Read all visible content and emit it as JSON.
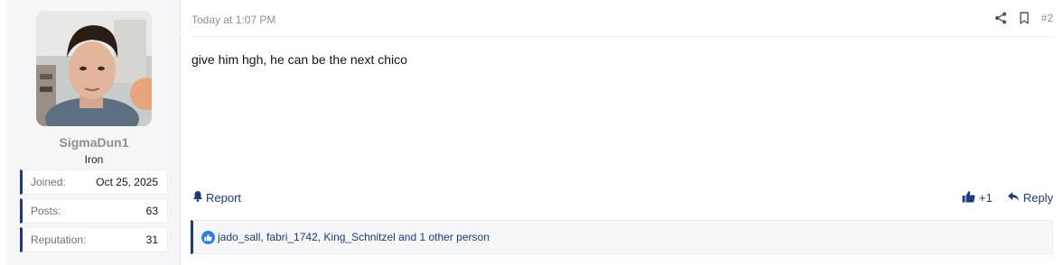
{
  "user": {
    "name": "SigmaDun1",
    "title": "Iron",
    "stats": [
      {
        "label": "Joined:",
        "value": "Oct 25, 2025"
      },
      {
        "label": "Posts:",
        "value": "63"
      },
      {
        "label": "Reputation:",
        "value": "31"
      }
    ]
  },
  "post": {
    "date": "Today at 1:07 PM",
    "number": "#2",
    "body": "give him hgh, he can be the next chico"
  },
  "footer": {
    "report_label": "Report",
    "like_count": "+1",
    "reply_label": "Reply"
  },
  "reactions": {
    "text": "jado_sall, fabri_1742, King_Schnitzel and 1 other person"
  },
  "colors": {
    "accent": "#1d3a7a",
    "like": "#2f7fd6"
  }
}
